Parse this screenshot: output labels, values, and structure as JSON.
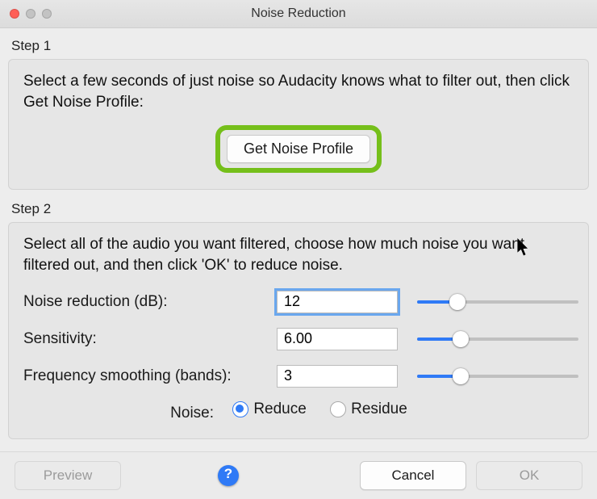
{
  "window": {
    "title": "Noise Reduction"
  },
  "step1": {
    "label": "Step 1",
    "instructions": "Select a few seconds of just noise so Audacity knows what to filter out, then click Get Noise Profile:",
    "get_profile_button": "Get Noise Profile"
  },
  "step2": {
    "label": "Step 2",
    "instructions": "Select all of the audio you want filtered, choose how much noise you want filtered out, and then click 'OK' to reduce noise.",
    "params": {
      "noise_reduction": {
        "label": "Noise reduction (dB):",
        "value": "12",
        "slider_percent": 25
      },
      "sensitivity": {
        "label": "Sensitivity:",
        "value": "6.00",
        "slider_percent": 27
      },
      "freq_smoothing": {
        "label": "Frequency smoothing (bands):",
        "value": "3",
        "slider_percent": 27
      }
    },
    "noise_radio": {
      "label": "Noise:",
      "reduce": "Reduce",
      "residue": "Residue",
      "selected": "reduce"
    }
  },
  "buttons": {
    "preview": "Preview",
    "cancel": "Cancel",
    "ok": "OK"
  }
}
